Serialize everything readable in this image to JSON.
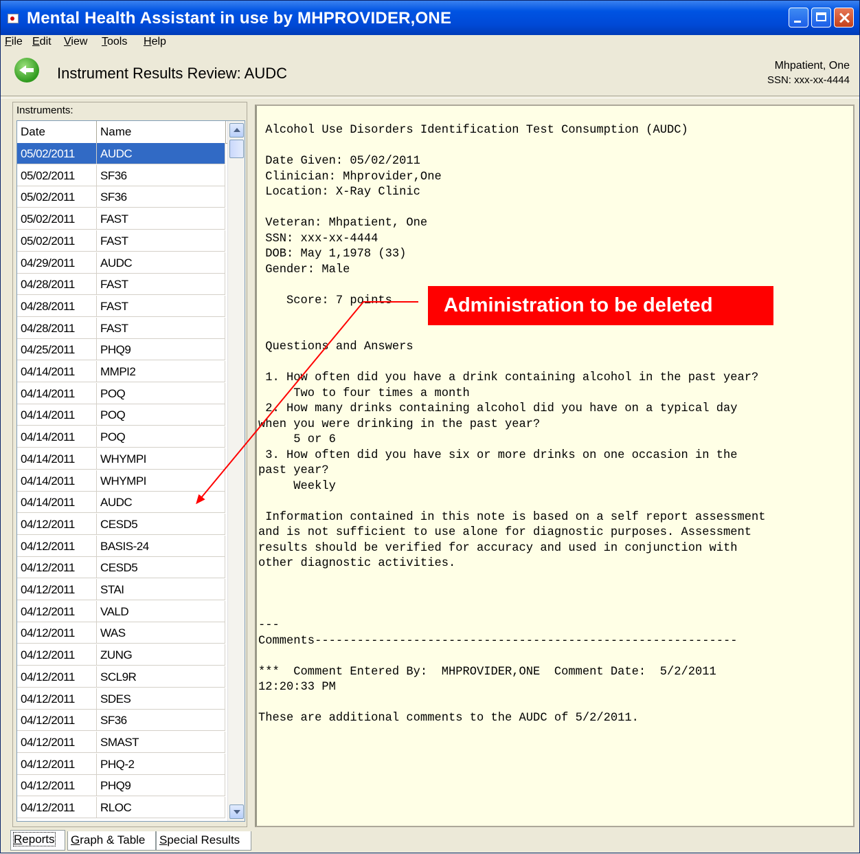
{
  "window": {
    "title": "Mental Health Assistant in use by MHPROVIDER,ONE",
    "controls": {
      "minimize": "minimize",
      "maximize": "maximize",
      "close": "close"
    }
  },
  "menu": [
    {
      "hotkey": "F",
      "rest": "ile"
    },
    {
      "hotkey": "E",
      "rest": "dit"
    },
    {
      "hotkey": "V",
      "rest": "iew"
    },
    {
      "hotkey": "T",
      "rest": "ools"
    },
    {
      "hotkey": "H",
      "rest": "elp"
    }
  ],
  "header": {
    "title": "Instrument Results Review: AUDC",
    "patient_name": "Mhpatient, One",
    "patient_ssn": "SSN: xxx-xx-4444"
  },
  "instruments": {
    "label": "Instruments:",
    "columns": [
      "Date",
      "Name"
    ],
    "selected_index": 0,
    "rows": [
      [
        "05/02/2011",
        "AUDC"
      ],
      [
        "05/02/2011",
        "SF36"
      ],
      [
        "05/02/2011",
        "SF36"
      ],
      [
        "05/02/2011",
        "FAST"
      ],
      [
        "05/02/2011",
        "FAST"
      ],
      [
        "04/29/2011",
        "AUDC"
      ],
      [
        "04/28/2011",
        "FAST"
      ],
      [
        "04/28/2011",
        "FAST"
      ],
      [
        "04/28/2011",
        "FAST"
      ],
      [
        "04/25/2011",
        "PHQ9"
      ],
      [
        "04/14/2011",
        "MMPI2"
      ],
      [
        "04/14/2011",
        "POQ"
      ],
      [
        "04/14/2011",
        "POQ"
      ],
      [
        "04/14/2011",
        "POQ"
      ],
      [
        "04/14/2011",
        "WHYMPI"
      ],
      [
        "04/14/2011",
        "WHYMPI"
      ],
      [
        "04/14/2011",
        "AUDC"
      ],
      [
        "04/12/2011",
        "CESD5"
      ],
      [
        "04/12/2011",
        "BASIS-24"
      ],
      [
        "04/12/2011",
        "CESD5"
      ],
      [
        "04/12/2011",
        "STAI"
      ],
      [
        "04/12/2011",
        "VALD"
      ],
      [
        "04/12/2011",
        "WAS"
      ],
      [
        "04/12/2011",
        "ZUNG"
      ],
      [
        "04/12/2011",
        "SCL9R"
      ],
      [
        "04/12/2011",
        "SDES"
      ],
      [
        "04/12/2011",
        "SF36"
      ],
      [
        "04/12/2011",
        "SMAST"
      ],
      [
        "04/12/2011",
        "PHQ-2"
      ],
      [
        "04/12/2011",
        "PHQ9"
      ],
      [
        "04/12/2011",
        "RLOC"
      ]
    ]
  },
  "report_text": " Alcohol Use Disorders Identification Test Consumption (AUDC)\n\n Date Given: 05/02/2011\n Clinician: Mhprovider,One\n Location: X-Ray Clinic\n\n Veteran: Mhpatient, One\n SSN: xxx-xx-4444\n DOB: May 1,1978 (33)\n Gender: Male\n\n    Score: 7 points\n\n\n Questions and Answers\n\n 1. How often did you have a drink containing alcohol in the past year?\n     Two to four times a month\n 2. How many drinks containing alcohol did you have on a typical day\nwhen you were drinking in the past year?\n     5 or 6\n 3. How often did you have six or more drinks on one occasion in the\npast year?\n     Weekly\n\n Information contained in this note is based on a self report assessment\nand is not sufficient to use alone for diagnostic purposes. Assessment\nresults should be verified for accuracy and used in conjunction with\nother diagnostic activities.\n\n\n\n---\nComments------------------------------------------------------------\n\n***  Comment Entered By:  MHPROVIDER,ONE  Comment Date:  5/2/2011\n12:20:33 PM\n\nThese are additional comments to the AUDC of 5/2/2011.",
  "annotation": {
    "text": "Administration to be deleted",
    "color": "#ff0000"
  },
  "tabs": [
    {
      "hotkey": "R",
      "rest": "eports",
      "pre": ""
    },
    {
      "hotkey": "G",
      "rest": "raph & Table",
      "pre": ""
    },
    {
      "hotkey": "S",
      "rest": "pecial Results",
      "pre": ""
    }
  ],
  "active_tab": 0,
  "colors": {
    "selection": "#316ac5",
    "report_bg": "#ffffe6",
    "titlebar": "#0054e3"
  }
}
